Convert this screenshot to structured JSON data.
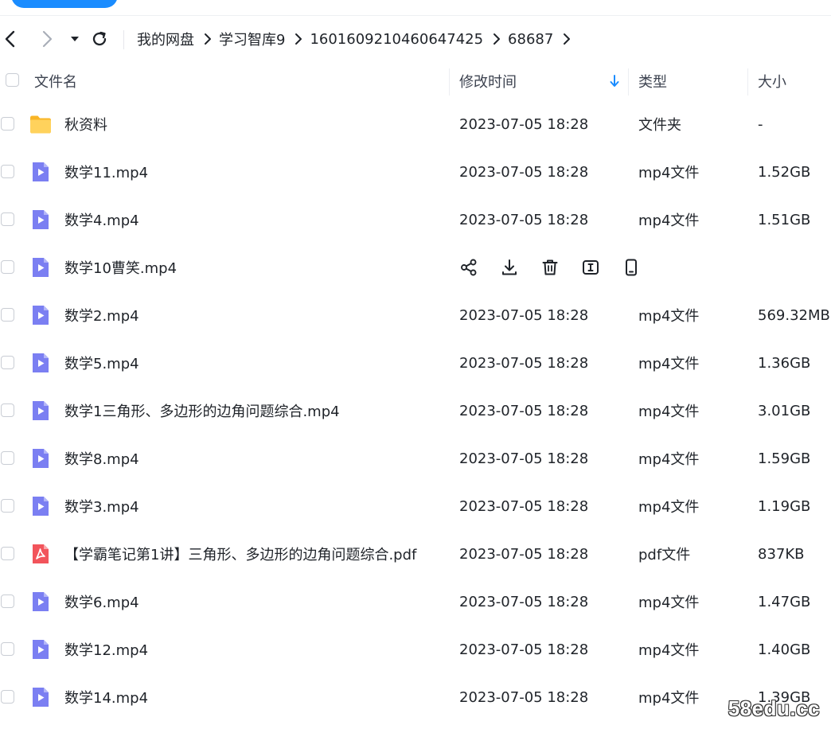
{
  "navigation": {
    "breadcrumb": [
      "我的网盘",
      "学习智库9",
      "1601609210460647425",
      "68687"
    ]
  },
  "table": {
    "columns": {
      "name": "文件名",
      "modified": "修改时间",
      "type": "类型",
      "size": "大小"
    },
    "rows": [
      {
        "name": "秋资料",
        "icon": "folder-icon",
        "time": "2023-07-05 18:28",
        "type": "文件夹",
        "size": "-"
      },
      {
        "name": "数学11.mp4",
        "icon": "video-file-icon",
        "time": "2023-07-05 18:28",
        "type": "mp4文件",
        "size": "1.52GB"
      },
      {
        "name": "数学4.mp4",
        "icon": "video-file-icon",
        "time": "2023-07-05 18:28",
        "type": "mp4文件",
        "size": "1.51GB"
      },
      {
        "name": "数学10曹笑.mp4",
        "icon": "video-file-icon",
        "hovered": true
      },
      {
        "name": "数学2.mp4",
        "icon": "video-file-icon",
        "time": "2023-07-05 18:28",
        "type": "mp4文件",
        "size": "569.32MB"
      },
      {
        "name": "数学5.mp4",
        "icon": "video-file-icon",
        "time": "2023-07-05 18:28",
        "type": "mp4文件",
        "size": "1.36GB"
      },
      {
        "name": "数学1三角形、多边形的边角问题综合.mp4",
        "icon": "video-file-icon",
        "time": "2023-07-05 18:28",
        "type": "mp4文件",
        "size": "3.01GB"
      },
      {
        "name": "数学8.mp4",
        "icon": "video-file-icon",
        "time": "2023-07-05 18:28",
        "type": "mp4文件",
        "size": "1.59GB"
      },
      {
        "name": "数学3.mp4",
        "icon": "video-file-icon",
        "time": "2023-07-05 18:28",
        "type": "mp4文件",
        "size": "1.19GB"
      },
      {
        "name": "【学霸笔记第1讲】三角形、多边形的边角问题综合.pdf",
        "icon": "pdf-file-icon",
        "time": "2023-07-05 18:28",
        "type": "pdf文件",
        "size": "837KB"
      },
      {
        "name": "数学6.mp4",
        "icon": "video-file-icon",
        "time": "2023-07-05 18:28",
        "type": "mp4文件",
        "size": "1.47GB"
      },
      {
        "name": "数学12.mp4",
        "icon": "video-file-icon",
        "time": "2023-07-05 18:28",
        "type": "mp4文件",
        "size": "1.40GB"
      },
      {
        "name": "数学14.mp4",
        "icon": "video-file-icon",
        "time": "2023-07-05 18:28",
        "type": "mp4文件",
        "size": "1.39GB"
      }
    ]
  },
  "row_actions": [
    "share-icon",
    "download-icon",
    "delete-icon",
    "rename-icon",
    "phone-icon"
  ],
  "colors": {
    "accent": "#1a8cff",
    "video": "#7b7ff2",
    "folder": "#ffc93d",
    "pdf": "#f2545b"
  },
  "watermark": "58edu.cc"
}
